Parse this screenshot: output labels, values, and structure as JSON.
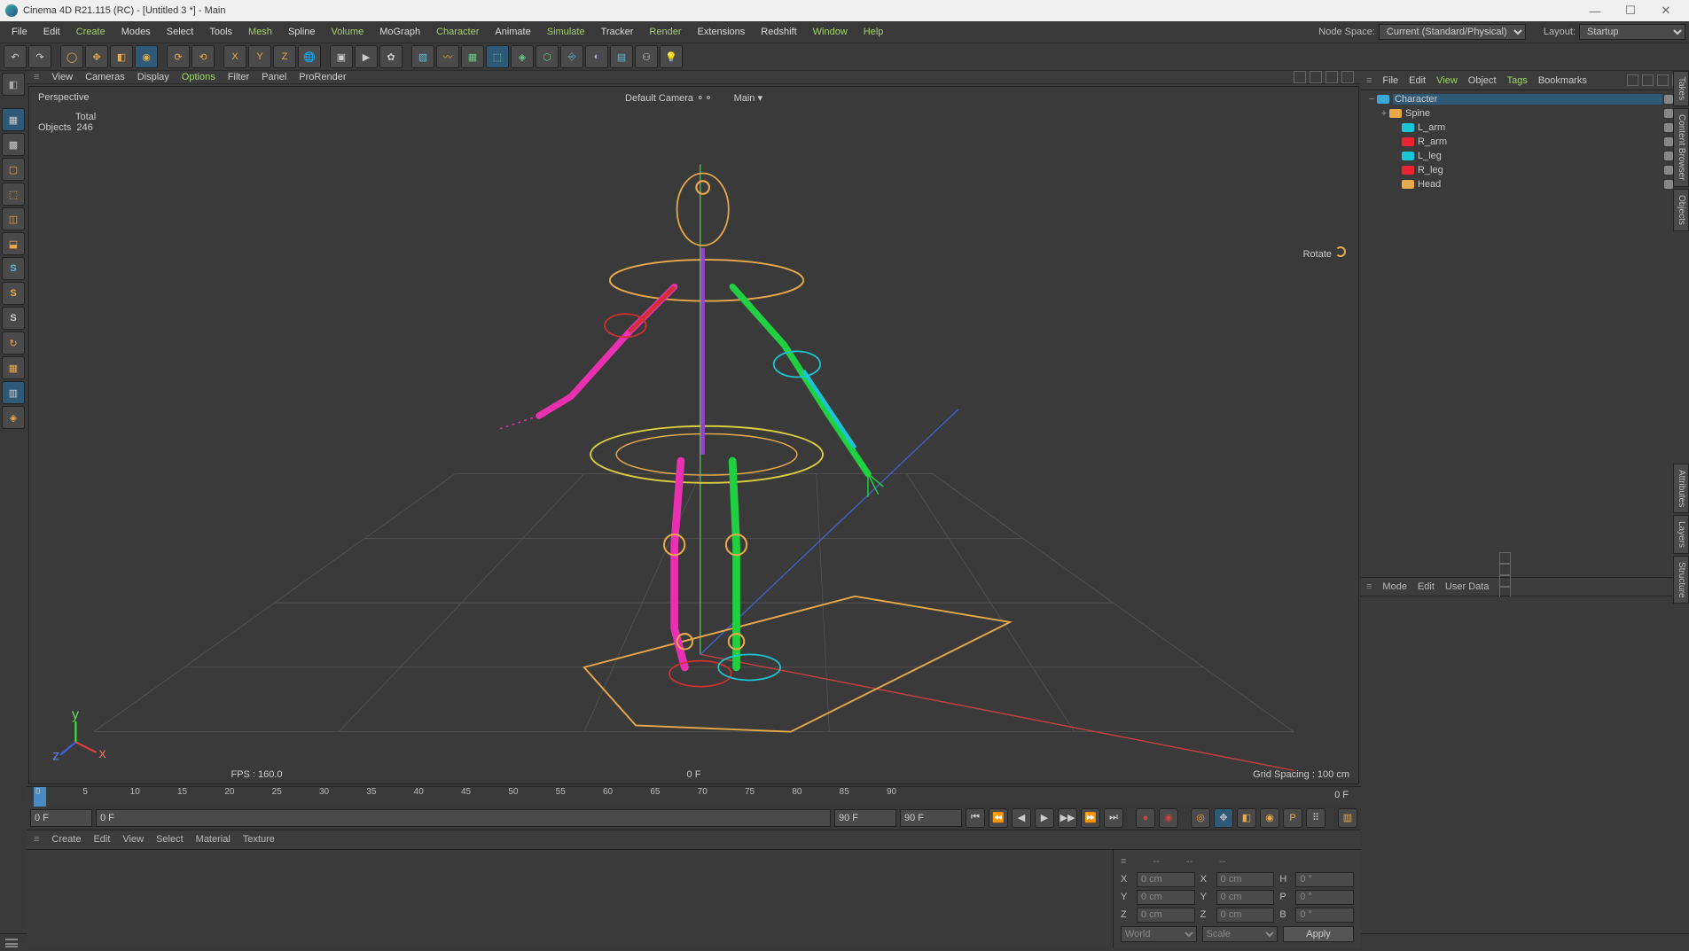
{
  "titlebar": {
    "title": "Cinema 4D R21.115 (RC) - [Untitled 3 *] - Main"
  },
  "menu": {
    "items": [
      "File",
      "Edit",
      "Create",
      "Modes",
      "Select",
      "Tools",
      "Mesh",
      "Spline",
      "Volume",
      "MoGraph",
      "Character",
      "Animate",
      "Simulate",
      "Tracker",
      "Render",
      "Extensions",
      "Redshift",
      "Window",
      "Help"
    ],
    "nodeSpaceLabel": "Node Space:",
    "nodeSpaceValue": "Current (Standard/Physical)",
    "layoutLabel": "Layout:",
    "layoutValue": "Startup"
  },
  "viewportMenu": {
    "items": [
      "View",
      "Cameras",
      "Display",
      "Options",
      "Filter",
      "Panel",
      "ProRender"
    ],
    "highlighted": "Options"
  },
  "viewport": {
    "label": "Perspective",
    "statsTotalHeader": "Total",
    "statsObjectsLabel": "Objects",
    "statsObjectsCount": "246",
    "defaultCamera": "Default Camera",
    "take": "Main",
    "fps": "FPS : 160.0",
    "frame": "0 F",
    "gridSpacing": "Grid Spacing : 100 cm",
    "rotateLabel": "Rotate"
  },
  "timeline": {
    "ticks": [
      "0",
      "5",
      "10",
      "15",
      "20",
      "25",
      "30",
      "35",
      "40",
      "45",
      "50",
      "55",
      "60",
      "65",
      "70",
      "75",
      "80",
      "85",
      "90"
    ],
    "startFrame": "0 F",
    "startRange": "0 F",
    "endRange": "90 F",
    "endFrame": "90 F",
    "rightFrame": "0 F"
  },
  "materialMenu": {
    "items": [
      "Create",
      "Edit",
      "View",
      "Select",
      "Material",
      "Texture"
    ],
    "highlighted": "Create"
  },
  "coords": {
    "header": [
      "--",
      "--",
      "--"
    ],
    "X": {
      "pos": "0 cm",
      "size": "0 cm",
      "rotLabel": "H",
      "rot": "0 °"
    },
    "Y": {
      "pos": "0 cm",
      "size": "0 cm",
      "rotLabel": "P",
      "rot": "0 °"
    },
    "Z": {
      "pos": "0 cm",
      "size": "0 cm",
      "rotLabel": "B",
      "rot": "0 °"
    },
    "mode1": "World",
    "mode2": "Scale",
    "applyLabel": "Apply"
  },
  "objectsMenu": {
    "items": [
      "File",
      "Edit",
      "View",
      "Object",
      "Tags",
      "Bookmarks"
    ],
    "highlighted": "View"
  },
  "hierarchy": [
    {
      "name": "Character",
      "depth": 0,
      "expand": "−",
      "iconColor": "#3aa7d8",
      "selected": true
    },
    {
      "name": "Spine",
      "depth": 1,
      "expand": "+",
      "iconColor": "#e8a94a"
    },
    {
      "name": "L_arm",
      "depth": 2,
      "expand": "",
      "iconColor": "#19c6d6"
    },
    {
      "name": "R_arm",
      "depth": 2,
      "expand": "",
      "iconColor": "#e23"
    },
    {
      "name": "L_leg",
      "depth": 2,
      "expand": "",
      "iconColor": "#19c6d6"
    },
    {
      "name": "R_leg",
      "depth": 2,
      "expand": "",
      "iconColor": "#e23"
    },
    {
      "name": "Head",
      "depth": 2,
      "expand": "",
      "iconColor": "#e8a94a"
    }
  ],
  "attrMenu": {
    "items": [
      "Mode",
      "Edit",
      "User Data"
    ]
  },
  "rightTabs": [
    "Takes",
    "Content Browser",
    "Objects",
    "Attributes",
    "Layers",
    "Structure"
  ]
}
